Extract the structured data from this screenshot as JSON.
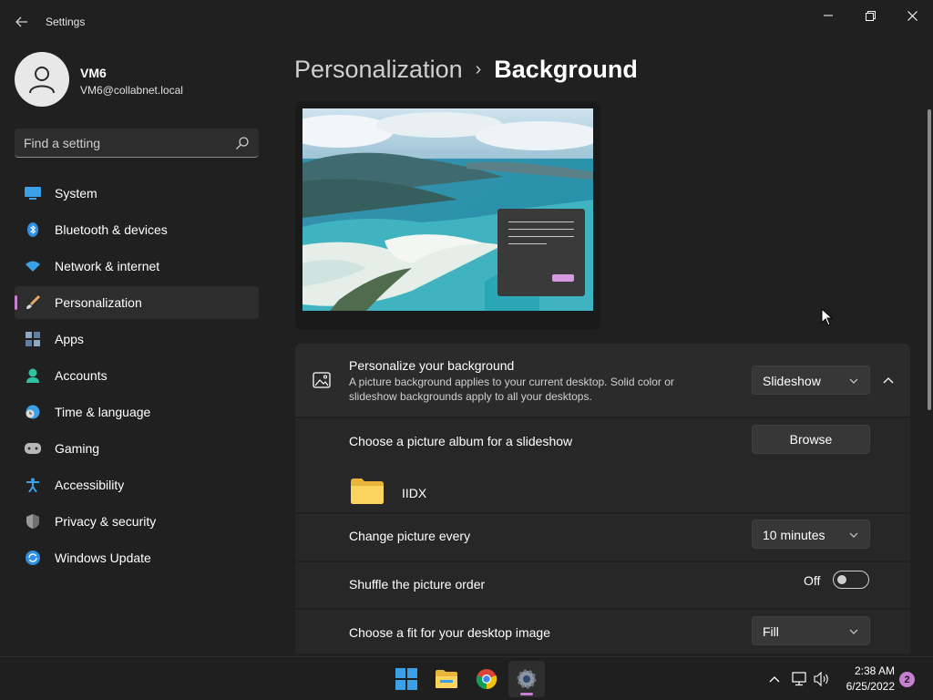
{
  "window": {
    "title": "Settings"
  },
  "user": {
    "name": "VM6",
    "email": "VM6@collabnet.local"
  },
  "search": {
    "placeholder": "Find a setting"
  },
  "sidebar": {
    "items": [
      {
        "label": "System",
        "icon": "system-icon",
        "active": false
      },
      {
        "label": "Bluetooth & devices",
        "icon": "bluetooth-icon",
        "active": false
      },
      {
        "label": "Network & internet",
        "icon": "wifi-icon",
        "active": false
      },
      {
        "label": "Personalization",
        "icon": "brush-icon",
        "active": true
      },
      {
        "label": "Apps",
        "icon": "apps-icon",
        "active": false
      },
      {
        "label": "Accounts",
        "icon": "person-icon",
        "active": false
      },
      {
        "label": "Time & language",
        "icon": "clock-globe-icon",
        "active": false
      },
      {
        "label": "Gaming",
        "icon": "gamepad-icon",
        "active": false
      },
      {
        "label": "Accessibility",
        "icon": "accessibility-icon",
        "active": false
      },
      {
        "label": "Privacy & security",
        "icon": "shield-icon",
        "active": false
      },
      {
        "label": "Windows Update",
        "icon": "update-icon",
        "active": false
      }
    ]
  },
  "breadcrumb": {
    "parent": "Personalization",
    "separator": "›",
    "current": "Background"
  },
  "background": {
    "title": "Personalize your background",
    "description": "A picture background applies to your current desktop. Solid color or slideshow backgrounds apply to all your desktops.",
    "type_value": "Slideshow"
  },
  "album": {
    "label": "Choose a picture album for a slideshow",
    "browse_label": "Browse",
    "folder_name": "IIDX"
  },
  "interval": {
    "label": "Change picture every",
    "value": "10 minutes"
  },
  "shuffle": {
    "label": "Shuffle the picture order",
    "state_label": "Off",
    "enabled": false
  },
  "fit": {
    "label": "Choose a fit for your desktop image",
    "value": "Fill"
  },
  "taskbar": {
    "apps": [
      "start-icon",
      "file-explorer-icon",
      "chrome-icon",
      "settings-icon"
    ],
    "clock_time": "2:38 AM",
    "clock_date": "6/25/2022",
    "notification_count": "2"
  },
  "colors": {
    "accent": "#c77fd0",
    "background": "#202020",
    "card": "#2b2b2b"
  }
}
